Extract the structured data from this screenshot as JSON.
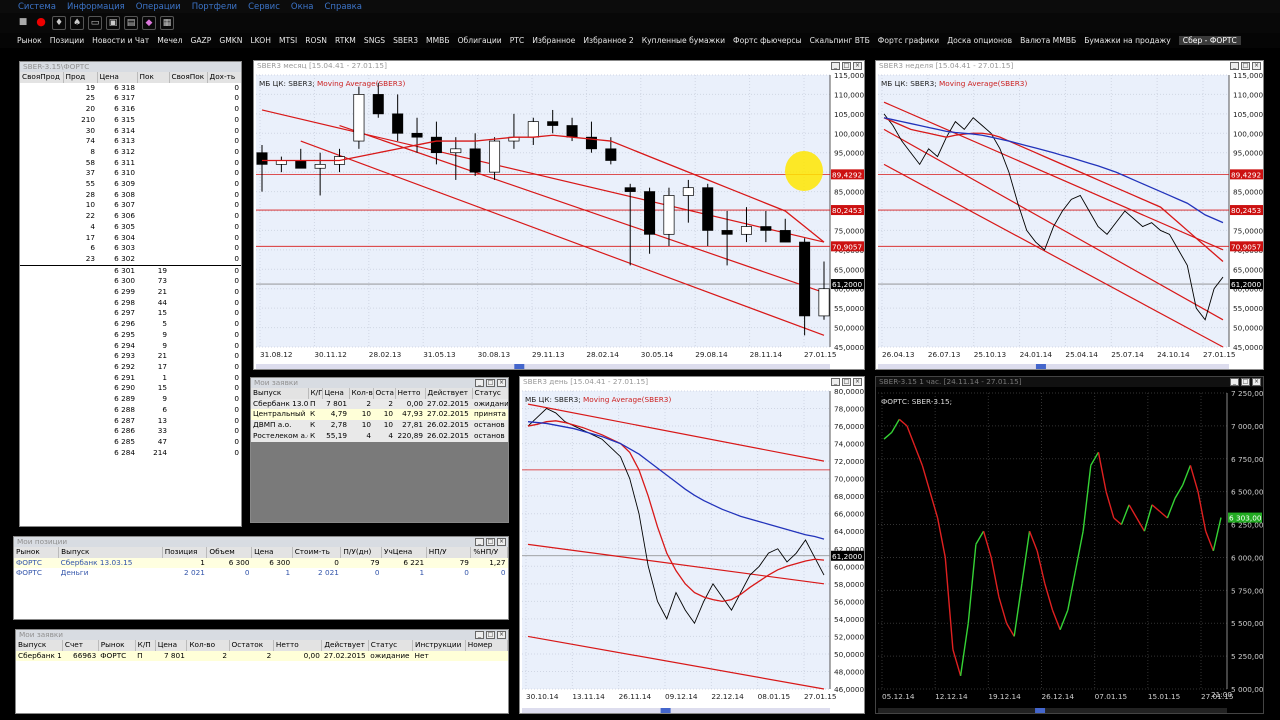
{
  "menu": [
    "Система",
    "Информация",
    "Операции",
    "Портфели",
    "Сервис",
    "Окна",
    "Справка"
  ],
  "tabs": [
    "Рынок",
    "Позиции",
    "Новости и Чат",
    "Мечел",
    "GAZP",
    "GMKN",
    "LKOH",
    "MTSI",
    "ROSN",
    "RTKM",
    "SNGS",
    "SBER3",
    "ММВБ",
    "Облигации",
    "РТС",
    "Избранное",
    "Избранное 2",
    "Купленные бумажки",
    "Фортс фьючерсы",
    "Скальпинг ВТБ",
    "Фортс графики",
    "Доска опционов",
    "Валюта ММВБ",
    "Бумажки на продажу",
    "Сбер - ФОРТС"
  ],
  "active_tab": "Сбер - ФОРТС",
  "orderbook": {
    "title": "SBER-3.15\\ФОРТС",
    "headers": [
      "СвояПрод",
      "Прод",
      "Цена",
      "Пок",
      "СвояПок",
      "Дох-ть"
    ],
    "asks": [
      [
        "19",
        "6 318"
      ],
      [
        "25",
        "6 317"
      ],
      [
        "20",
        "6 316"
      ],
      [
        "210",
        "6 315"
      ],
      [
        "30",
        "6 314"
      ],
      [
        "74",
        "6 313"
      ],
      [
        "8",
        "6 312"
      ],
      [
        "58",
        "6 311"
      ],
      [
        "37",
        "6 310"
      ],
      [
        "55",
        "6 309"
      ],
      [
        "28",
        "6 308"
      ],
      [
        "10",
        "6 307"
      ],
      [
        "22",
        "6 306"
      ],
      [
        "4",
        "6 305"
      ],
      [
        "17",
        "6 304"
      ],
      [
        "6",
        "6 303"
      ],
      [
        "23",
        "6 302"
      ]
    ],
    "bids": [
      [
        "6 301",
        "19"
      ],
      [
        "6 300",
        "73"
      ],
      [
        "6 299",
        "21"
      ],
      [
        "6 298",
        "44"
      ],
      [
        "6 297",
        "15"
      ],
      [
        "6 296",
        "5"
      ],
      [
        "6 295",
        "9"
      ],
      [
        "6 294",
        "9"
      ],
      [
        "6 293",
        "21"
      ],
      [
        "6 292",
        "17"
      ],
      [
        "6 291",
        "1"
      ],
      [
        "6 290",
        "15"
      ],
      [
        "6 289",
        "9"
      ],
      [
        "6 288",
        "6"
      ],
      [
        "6 287",
        "13"
      ],
      [
        "6 286",
        "33"
      ],
      [
        "6 285",
        "47"
      ],
      [
        "6 284",
        "214"
      ]
    ],
    "zero": "0"
  },
  "orders_top": {
    "title": "Мои заявки",
    "headers": [
      "Выпуск",
      "К/П",
      "Цена",
      "Кол-во",
      "Оста",
      "Нетто",
      "Действует",
      "Статус"
    ],
    "rows": [
      [
        "Сбербанк 13.0",
        "П",
        "7 801",
        "2",
        "2",
        "0,00",
        "27.02.2015",
        "ожидание"
      ],
      [
        "Центральный",
        "К",
        "4,79",
        "10",
        "10",
        "47,93",
        "27.02.2015",
        "принята"
      ],
      [
        "ДВМП а.о.",
        "К",
        "2,78",
        "10",
        "10",
        "27,81",
        "26.02.2015",
        "останов"
      ],
      [
        "Ростелеком а.о",
        "К",
        "55,19",
        "4",
        "4",
        "220,89",
        "26.02.2015",
        "останов"
      ]
    ]
  },
  "positions": {
    "title": "Мои позиции",
    "headers": [
      "Рынок",
      "Выпуск",
      "Позиция",
      "Объем",
      "Цена",
      "Стоим-ть",
      "П/У(дн)",
      "УчЦена",
      "НП/У",
      "%НП/У"
    ],
    "rows": [
      [
        "ФОРТС",
        "Сбербанк 13.03.15",
        "1",
        "6 300",
        "6 300",
        "0",
        "79",
        "6 221",
        "79",
        "1,27"
      ],
      [
        "ФОРТС",
        "Деньги",
        "2 021",
        "0",
        "1",
        "2 021",
        "0",
        "1",
        "0",
        "0"
      ]
    ]
  },
  "orders_bottom": {
    "title": "Мои заявки",
    "headers": [
      "Выпуск",
      "Счет",
      "Рынок",
      "К/П",
      "Цена",
      "Кол-во",
      "Остаток",
      "Нетто",
      "Действует",
      "Статус",
      "Инструкции",
      "Номер"
    ],
    "rows": [
      [
        "Сбербанк 13.03",
        "66963",
        "ФОРТС",
        "П",
        "7 801",
        "2",
        "2",
        "0,00",
        "27.02.2015",
        "ожидание",
        "Нет",
        ""
      ]
    ]
  },
  "colors": {
    "chart_bg": "#eaf0fb",
    "dark_bg": "#000000",
    "red": "#d81818",
    "blue": "#2233bb",
    "up": "#35d335",
    "down": "#e02020",
    "level_box": "#cc1111"
  },
  "chart_data": [
    {
      "type": "candlestick",
      "title": "SBER3 месяц [15.04.41 - 27.01.15]",
      "legend": "МБ ЦК: SBER3; Moving Average(SBER3)",
      "ylim": [
        45000,
        115000
      ],
      "yticks": [
        "115,0000",
        "110,0000",
        "105,0000",
        "100,0000",
        "95,0000",
        "90,0000",
        "85,0000",
        "80,0000",
        "75,0000",
        "70,0000",
        "65,0000",
        "60,0000",
        "55,0000",
        "50,0000",
        "45,0000"
      ],
      "xticks": [
        "31.08.12",
        "30.11.12",
        "28.02.13",
        "31.05.13",
        "30.08.13",
        "29.11.13",
        "28.02.14",
        "30.05.14",
        "29.08.14",
        "28.11.14",
        "27.01.15"
      ],
      "levels": [
        {
          "label": "89,4292",
          "value": 89429
        },
        {
          "label": "80,2453",
          "value": 80245
        },
        {
          "label": "70,9057",
          "value": 70906
        },
        {
          "label": "61,2000",
          "value": 61200,
          "current": true
        }
      ],
      "ohlc": [
        [
          95000,
          97000,
          85000,
          92000
        ],
        [
          92000,
          94000,
          90000,
          93000
        ],
        [
          93000,
          96000,
          92000,
          91000
        ],
        [
          91000,
          95000,
          84000,
          92000
        ],
        [
          92000,
          96000,
          90000,
          94000
        ],
        [
          98000,
          112000,
          96000,
          110000
        ],
        [
          110000,
          113000,
          104000,
          105000
        ],
        [
          105000,
          110000,
          98000,
          100000
        ],
        [
          100000,
          104000,
          95000,
          99000
        ],
        [
          99000,
          103000,
          92000,
          95000
        ],
        [
          95000,
          99000,
          88000,
          96000
        ],
        [
          96000,
          100000,
          89000,
          90000
        ],
        [
          90000,
          99000,
          88000,
          98000
        ],
        [
          98000,
          105000,
          96000,
          99000
        ],
        [
          99000,
          104000,
          97000,
          103000
        ],
        [
          103000,
          106000,
          100000,
          102000
        ],
        [
          102000,
          104000,
          98000,
          99000
        ],
        [
          99000,
          103000,
          95000,
          96000
        ],
        [
          96000,
          99000,
          92000,
          93000
        ],
        [
          86000,
          87000,
          66000,
          85000
        ],
        [
          85000,
          86000,
          69000,
          74000
        ],
        [
          74000,
          86000,
          71000,
          84000
        ],
        [
          84000,
          88000,
          77000,
          86000
        ],
        [
          86000,
          87000,
          71000,
          75000
        ],
        [
          75000,
          80000,
          66000,
          74000
        ],
        [
          74000,
          81000,
          72000,
          76000
        ],
        [
          76000,
          80000,
          72000,
          75000
        ],
        [
          75000,
          78000,
          72000,
          72000
        ],
        [
          72000,
          73000,
          48000,
          53000
        ],
        [
          53000,
          67000,
          52000,
          60000
        ]
      ],
      "ma": [
        93000,
        93000,
        93000,
        93000,
        93000,
        94000,
        95000,
        96000,
        97000,
        98000,
        98000,
        98000,
        98500,
        99000,
        99000,
        99500,
        99000,
        98500,
        98000,
        96000,
        94000,
        92000,
        90000,
        88000,
        86000,
        84000,
        82000,
        80000,
        76000,
        72000
      ],
      "channels": [
        [
          [
            0,
            106000
          ],
          [
            29,
            72000
          ]
        ],
        [
          [
            4,
            102000
          ],
          [
            29,
            59000
          ]
        ],
        [
          [
            2,
            98000
          ],
          [
            29,
            48000
          ]
        ]
      ]
    },
    {
      "type": "line",
      "title": "SBER3 неделя [15.04.41 - 27.01.15]",
      "legend": "МБ ЦК: SBER3; Moving Average(SBER3)",
      "ylim": [
        45000,
        115000
      ],
      "yticks": [
        "115,0000",
        "110,0000",
        "105,0000",
        "100,0000",
        "95,0000",
        "90,0000",
        "85,0000",
        "80,0000",
        "75,0000",
        "70,0000",
        "65,0000",
        "60,0000",
        "55,0000",
        "50,0000",
        "45,0000"
      ],
      "xticks": [
        "26.04.13",
        "26.07.13",
        "25.10.13",
        "24.01.14",
        "25.04.14",
        "25.07.14",
        "24.10.14",
        "27.01.15"
      ],
      "levels": [
        {
          "label": "89,4292",
          "value": 89429
        },
        {
          "label": "80,2453",
          "value": 80245
        },
        {
          "label": "70,9057",
          "value": 70906
        },
        {
          "label": "61,2000",
          "value": 61200,
          "current": true
        }
      ],
      "price": [
        105000,
        102000,
        98000,
        95000,
        92000,
        96000,
        94000,
        99000,
        103000,
        101000,
        104000,
        102000,
        100000,
        96000,
        90000,
        82000,
        75000,
        72000,
        70000,
        76000,
        80000,
        83000,
        84000,
        80000,
        76000,
        74000,
        77000,
        80000,
        78000,
        76000,
        77000,
        75000,
        74000,
        70000,
        66000,
        55000,
        52000,
        60000,
        63000
      ],
      "ma": [
        104000,
        103000,
        102000,
        101000,
        100500,
        100000,
        99500,
        99000,
        99500,
        99800,
        100000,
        100000,
        99700,
        99000,
        98000,
        97000,
        96000,
        95000,
        94000,
        93000,
        92000,
        91000,
        90000,
        89000,
        88000,
        87000,
        86000,
        85000,
        84000,
        83000,
        82000,
        81000,
        79000,
        77000,
        75000,
        73000,
        71000,
        69000,
        67000
      ],
      "blue_ma": [
        104000,
        103500,
        103000,
        102500,
        102000,
        101500,
        101000,
        100500,
        100200,
        100000,
        99800,
        99500,
        99000,
        98500,
        98000,
        97400,
        96800,
        96200,
        95600,
        95000,
        94300,
        93700,
        93000,
        92300,
        91600,
        90800,
        90000,
        89000,
        88000,
        87000,
        86000,
        85000,
        84000,
        83000,
        82000,
        80500,
        79000,
        78000,
        77000
      ],
      "channels": [
        [
          [
            0,
            108000
          ],
          [
            38,
            70000
          ]
        ],
        [
          [
            0,
            101000
          ],
          [
            38,
            52000
          ]
        ],
        [
          [
            0,
            92000
          ],
          [
            38,
            45000
          ]
        ]
      ]
    },
    {
      "type": "line",
      "title": "SBER3 день [15.04.41 - 27.01.15]",
      "legend": "МБ ЦК: SBER3; Moving Average(SBER3)",
      "ylim": [
        46000,
        80000
      ],
      "yticks": [
        "80,0000",
        "78,0000",
        "76,0000",
        "74,0000",
        "72,0000",
        "70,0000",
        "68,0000",
        "66,0000",
        "64,0000",
        "62,0000",
        "60,0000",
        "58,0000",
        "56,0000",
        "54,0000",
        "52,0000",
        "50,0000",
        "48,0000",
        "46,0000"
      ],
      "xticks": [
        "30.10.14",
        "13.11.14",
        "26.11.14",
        "09.12.14",
        "22.12.14",
        "08.01.15",
        "27.01.15"
      ],
      "levels": [
        {
          "label": "61,2000",
          "value": 61200,
          "current": true
        }
      ],
      "price": [
        76000,
        77000,
        78000,
        77500,
        76500,
        76000,
        75500,
        75000,
        74500,
        73500,
        72500,
        70000,
        66000,
        60000,
        56000,
        54000,
        57000,
        55000,
        53500,
        56000,
        58000,
        56500,
        55000,
        57000,
        59000,
        60000,
        61500,
        62000,
        60500,
        61500,
        63000,
        61000,
        59000
      ],
      "ma": [
        76000,
        76200,
        76500,
        76600,
        76400,
        76100,
        75800,
        75400,
        75000,
        74500,
        74000,
        73000,
        71000,
        68000,
        64500,
        61500,
        59500,
        58000,
        57000,
        56500,
        56200,
        56000,
        56200,
        56800,
        57600,
        58300,
        59000,
        59600,
        60000,
        60300,
        60600,
        60800,
        60700
      ],
      "blue_ma": [
        76500,
        76400,
        76300,
        76100,
        75900,
        75700,
        75400,
        75100,
        74800,
        74400,
        74000,
        73400,
        72800,
        72000,
        71200,
        70400,
        69600,
        68800,
        68100,
        67500,
        67000,
        66500,
        66100,
        65700,
        65400,
        65100,
        64800,
        64500,
        64200,
        63900,
        63600,
        63400,
        63100
      ],
      "channels": [
        [
          [
            0,
            78500
          ],
          [
            32,
            72000
          ]
        ],
        [
          [
            0,
            62500
          ],
          [
            32,
            58000
          ]
        ],
        [
          [
            0,
            52000
          ],
          [
            32,
            46000
          ]
        ]
      ],
      "hline": 71000
    },
    {
      "type": "line",
      "title": "SBER-3.15 1 час. [24.11.14 - 27.01.15]",
      "legend": "ФОРТС: SBER-3.15",
      "ylim": [
        5000,
        7250
      ],
      "yticks": [
        "7 250,00",
        "7 000,00",
        "6 750,00",
        "6 500,00",
        "6 250,00",
        "6 000,00",
        "5 750,00",
        "5 500,00",
        "5 250,00",
        "5 000,00"
      ],
      "xticks": [
        "05.12.14",
        "12.12.14",
        "19.12.14",
        "26.12.14",
        "07.01.15",
        "15.01.15",
        "27.01.15"
      ],
      "extra_label": "21:00",
      "current_label": "6 303,00",
      "current_value": 6303,
      "price": [
        6900,
        6950,
        7050,
        7000,
        6850,
        6700,
        6500,
        6300,
        6000,
        5300,
        5100,
        5500,
        6100,
        6200,
        6000,
        5700,
        5500,
        5400,
        5800,
        6200,
        6050,
        5800,
        5600,
        5450,
        5600,
        5900,
        6200,
        6700,
        6800,
        6500,
        6300,
        6250,
        6400,
        6300,
        6200,
        6400,
        6350,
        6300,
        6450,
        6550,
        6700,
        6500,
        6200,
        6050,
        6303
      ]
    }
  ]
}
